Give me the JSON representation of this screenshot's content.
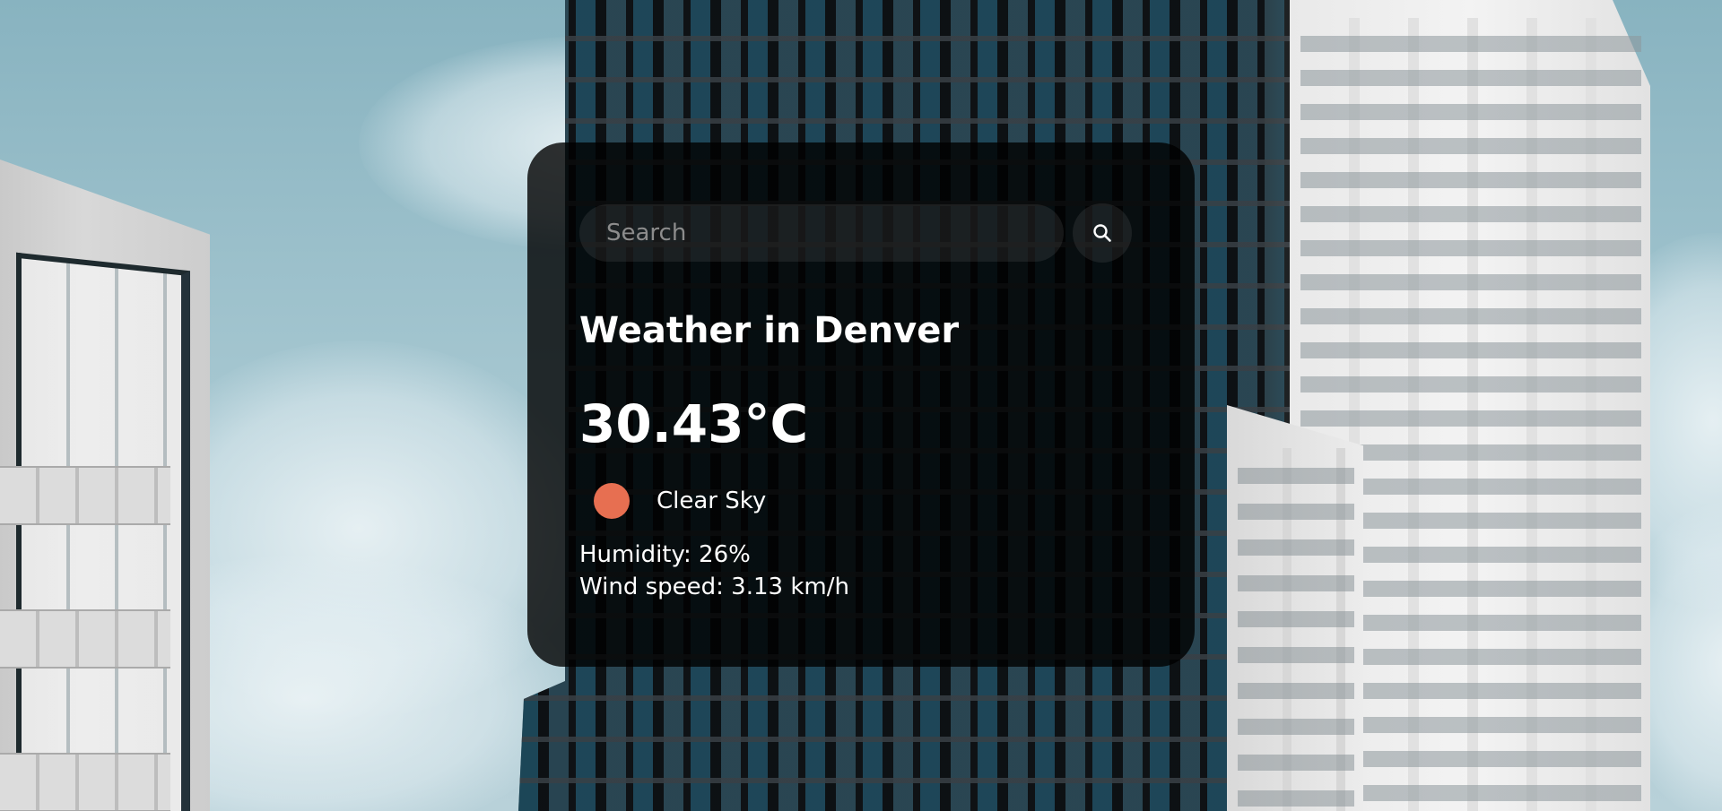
{
  "search": {
    "placeholder": "Search"
  },
  "weather": {
    "title": "Weather in Denver",
    "temperature": "30.43°C",
    "condition": "Clear Sky",
    "condition_icon": "sun-icon",
    "condition_icon_color": "#e76f51",
    "humidity": "Humidity: 26%",
    "wind": "Wind speed: 3.13 km/h"
  },
  "background": {
    "scene": "city-buildings-image",
    "sky_color": "#a3c5cf"
  },
  "colors": {
    "card": "#000000",
    "text": "#ffffff",
    "accent": "#e76f51"
  }
}
